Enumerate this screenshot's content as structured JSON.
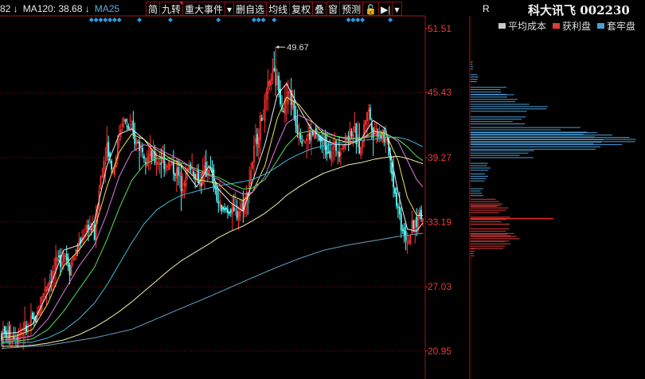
{
  "ma_legend": [
    {
      "text": "82 ↓",
      "color": "#e8e8e8"
    },
    {
      "text": "MA120: 38.68 ↓",
      "color": "#e8e8e8"
    },
    {
      "text": "MA25",
      "color": "#5fb0d6"
    }
  ],
  "toolbar": [
    {
      "label": "简",
      "flag": false
    },
    {
      "label": "九转",
      "flag": true
    },
    {
      "label": "重大事件",
      "flag": false
    },
    {
      "label": "▾",
      "flag": false
    },
    {
      "label": "删自选",
      "flag": false
    },
    {
      "label": "均线",
      "flag": false
    },
    {
      "label": "复权",
      "flag": false
    },
    {
      "label": "叠",
      "flag": false
    },
    {
      "label": "窗",
      "flag": false
    },
    {
      "label": "预测",
      "flag": false
    },
    {
      "label": "🔓",
      "flag": false
    },
    {
      "label": "▶|",
      "flag": false
    },
    {
      "label": "▾",
      "flag": false
    }
  ],
  "stock": {
    "name": "科大讯飞",
    "code": "002230",
    "title": "科大讯飞 002230",
    "corner": "R"
  },
  "chip_legend": [
    {
      "label": "平均成本",
      "color": "#c8c8c8"
    },
    {
      "label": "获利盘",
      "color": "#e23a3a"
    },
    {
      "label": "套牢盘",
      "color": "#4a9fd8"
    }
  ],
  "chip_cost_line": 33.5,
  "chart_data": {
    "type": "candlestick",
    "price_axis": {
      "ticks": [
        "51.51",
        "45.43",
        "39.27",
        "33.19",
        "27.03",
        "20.95"
      ],
      "ylim": [
        18.3,
        52.7
      ]
    },
    "peak_annotation": "49.67",
    "ma_series": [
      {
        "name": "MA5",
        "color": "#f0f0f0",
        "anchors": [
          [
            0,
            22.6
          ],
          [
            10,
            22.7
          ],
          [
            20,
            23.5
          ],
          [
            30,
            26.5
          ],
          [
            40,
            30.5
          ],
          [
            50,
            31.0
          ],
          [
            60,
            33.3
          ],
          [
            68,
            38.5
          ],
          [
            76,
            41.5
          ],
          [
            84,
            42.0
          ],
          [
            92,
            41.0
          ],
          [
            100,
            39.5
          ],
          [
            108,
            39.0
          ],
          [
            116,
            38.5
          ],
          [
            126,
            36.5
          ],
          [
            134,
            38.5
          ],
          [
            140,
            36.3
          ],
          [
            148,
            35.0
          ],
          [
            156,
            34.2
          ],
          [
            162,
            37.0
          ],
          [
            170,
            40.5
          ],
          [
            178,
            45.2
          ],
          [
            184,
            46.3
          ],
          [
            192,
            44.0
          ],
          [
            200,
            42.0
          ],
          [
            208,
            41.0
          ],
          [
            216,
            40.5
          ],
          [
            224,
            40.5
          ],
          [
            232,
            41.0
          ],
          [
            240,
            42.8
          ],
          [
            248,
            42.0
          ],
          [
            256,
            36.0
          ],
          [
            262,
            32.5
          ],
          [
            268,
            32.3
          ],
          [
            272,
            33.1
          ]
        ]
      },
      {
        "name": "MA10",
        "color": "#f2e25a",
        "anchors": [
          [
            0,
            22.2
          ],
          [
            10,
            22.4
          ],
          [
            20,
            23.0
          ],
          [
            30,
            25.5
          ],
          [
            40,
            29.0
          ],
          [
            50,
            30.5
          ],
          [
            60,
            32.5
          ],
          [
            68,
            36.5
          ],
          [
            76,
            39.8
          ],
          [
            84,
            41.5
          ],
          [
            92,
            41.0
          ],
          [
            100,
            40.0
          ],
          [
            108,
            39.3
          ],
          [
            116,
            38.6
          ],
          [
            126,
            37.2
          ],
          [
            134,
            37.0
          ],
          [
            140,
            36.8
          ],
          [
            148,
            35.7
          ],
          [
            156,
            35.2
          ],
          [
            162,
            36.0
          ],
          [
            170,
            38.5
          ],
          [
            178,
            43.0
          ],
          [
            184,
            45.0
          ],
          [
            192,
            44.3
          ],
          [
            200,
            42.8
          ],
          [
            208,
            41.5
          ],
          [
            216,
            41.0
          ],
          [
            224,
            40.7
          ],
          [
            232,
            41.0
          ],
          [
            240,
            41.8
          ],
          [
            248,
            41.6
          ],
          [
            256,
            39.0
          ],
          [
            262,
            35.5
          ],
          [
            268,
            33.8
          ],
          [
            272,
            33.8
          ]
        ]
      },
      {
        "name": "MA20",
        "color": "#e07ae0",
        "anchors": [
          [
            0,
            22.0
          ],
          [
            10,
            22.1
          ],
          [
            20,
            22.4
          ],
          [
            30,
            24.0
          ],
          [
            40,
            26.5
          ],
          [
            50,
            29.0
          ],
          [
            60,
            31.0
          ],
          [
            68,
            34.0
          ],
          [
            76,
            37.5
          ],
          [
            84,
            39.8
          ],
          [
            92,
            40.5
          ],
          [
            100,
            40.2
          ],
          [
            108,
            39.6
          ],
          [
            116,
            39.0
          ],
          [
            126,
            38.0
          ],
          [
            134,
            37.6
          ],
          [
            140,
            37.2
          ],
          [
            148,
            36.4
          ],
          [
            156,
            35.8
          ],
          [
            162,
            36.0
          ],
          [
            170,
            37.5
          ],
          [
            178,
            40.5
          ],
          [
            184,
            42.5
          ],
          [
            192,
            43.3
          ],
          [
            200,
            42.7
          ],
          [
            208,
            41.8
          ],
          [
            216,
            41.3
          ],
          [
            224,
            41.0
          ],
          [
            232,
            41.1
          ],
          [
            240,
            41.5
          ],
          [
            248,
            41.6
          ],
          [
            256,
            40.8
          ],
          [
            262,
            39.0
          ],
          [
            268,
            37.2
          ],
          [
            272,
            36.5
          ]
        ]
      },
      {
        "name": "MA30",
        "color": "#58e058",
        "anchors": [
          [
            0,
            21.8
          ],
          [
            10,
            21.9
          ],
          [
            20,
            22.1
          ],
          [
            30,
            23.0
          ],
          [
            40,
            24.7
          ],
          [
            50,
            26.8
          ],
          [
            60,
            28.9
          ],
          [
            68,
            31.5
          ],
          [
            76,
            34.5
          ],
          [
            84,
            37.1
          ],
          [
            92,
            38.6
          ],
          [
            100,
            39.2
          ],
          [
            108,
            39.2
          ],
          [
            116,
            38.8
          ],
          [
            126,
            38.2
          ],
          [
            134,
            37.7
          ],
          [
            140,
            37.4
          ],
          [
            148,
            36.8
          ],
          [
            156,
            36.3
          ],
          [
            162,
            36.4
          ],
          [
            170,
            37.2
          ],
          [
            178,
            39.0
          ],
          [
            184,
            40.4
          ],
          [
            192,
            41.6
          ],
          [
            200,
            41.8
          ],
          [
            208,
            41.6
          ],
          [
            216,
            41.3
          ],
          [
            224,
            41.1
          ],
          [
            232,
            41.1
          ],
          [
            240,
            41.3
          ],
          [
            248,
            41.5
          ],
          [
            256,
            41.0
          ],
          [
            262,
            40.3
          ],
          [
            268,
            39.4
          ],
          [
            272,
            39.0
          ]
        ]
      },
      {
        "name": "MA60",
        "color": "#44b8d8",
        "anchors": [
          [
            0,
            21.7
          ],
          [
            10,
            21.7
          ],
          [
            20,
            21.8
          ],
          [
            30,
            22.2
          ],
          [
            40,
            22.9
          ],
          [
            50,
            24.0
          ],
          [
            60,
            25.5
          ],
          [
            68,
            27.2
          ],
          [
            76,
            29.2
          ],
          [
            84,
            31.2
          ],
          [
            92,
            33.0
          ],
          [
            100,
            34.3
          ],
          [
            108,
            35.1
          ],
          [
            116,
            35.7
          ],
          [
            126,
            36.1
          ],
          [
            134,
            36.4
          ],
          [
            140,
            36.6
          ],
          [
            148,
            36.8
          ],
          [
            156,
            37.0
          ],
          [
            162,
            37.2
          ],
          [
            170,
            37.7
          ],
          [
            178,
            38.4
          ],
          [
            184,
            39.0
          ],
          [
            192,
            39.6
          ],
          [
            200,
            40.1
          ],
          [
            208,
            40.4
          ],
          [
            216,
            40.6
          ],
          [
            224,
            40.8
          ],
          [
            232,
            40.9
          ],
          [
            240,
            41.0
          ],
          [
            248,
            41.2
          ],
          [
            256,
            41.2
          ],
          [
            262,
            41.0
          ],
          [
            268,
            40.6
          ],
          [
            272,
            40.3
          ]
        ]
      },
      {
        "name": "MA120",
        "color": "#f4f0b0",
        "anchors": [
          [
            0,
            21.4
          ],
          [
            10,
            21.4
          ],
          [
            20,
            21.5
          ],
          [
            30,
            21.7
          ],
          [
            40,
            22.0
          ],
          [
            50,
            22.5
          ],
          [
            60,
            23.2
          ],
          [
            68,
            23.9
          ],
          [
            76,
            24.7
          ],
          [
            84,
            25.6
          ],
          [
            92,
            26.6
          ],
          [
            100,
            27.6
          ],
          [
            108,
            28.6
          ],
          [
            116,
            29.5
          ],
          [
            126,
            30.4
          ],
          [
            134,
            31.1
          ],
          [
            140,
            31.7
          ],
          [
            148,
            32.3
          ],
          [
            156,
            32.8
          ],
          [
            162,
            33.3
          ],
          [
            170,
            34.0
          ],
          [
            178,
            34.9
          ],
          [
            184,
            35.7
          ],
          [
            192,
            36.5
          ],
          [
            200,
            37.2
          ],
          [
            208,
            37.8
          ],
          [
            216,
            38.2
          ],
          [
            224,
            38.6
          ],
          [
            232,
            38.8
          ],
          [
            240,
            39.1
          ],
          [
            248,
            39.3
          ],
          [
            256,
            39.4
          ],
          [
            262,
            39.2
          ],
          [
            268,
            38.9
          ],
          [
            272,
            38.7
          ]
        ]
      },
      {
        "name": "MA250",
        "color": "#6aa0c0",
        "anchors": [
          [
            0,
            21.2
          ],
          [
            30,
            21.5
          ],
          [
            60,
            22.2
          ],
          [
            84,
            23.0
          ],
          [
            100,
            24.0
          ],
          [
            116,
            25.0
          ],
          [
            134,
            26.1
          ],
          [
            148,
            27.0
          ],
          [
            162,
            27.9
          ],
          [
            178,
            28.9
          ],
          [
            192,
            29.7
          ],
          [
            208,
            30.5
          ],
          [
            224,
            31.0
          ],
          [
            240,
            31.4
          ],
          [
            256,
            31.8
          ],
          [
            272,
            32.1
          ]
        ]
      }
    ],
    "price_path_anchors": [
      [
        0,
        22.5
      ],
      [
        8,
        22.6
      ],
      [
        16,
        23.0
      ],
      [
        22,
        24.0
      ],
      [
        28,
        27.0
      ],
      [
        34,
        28.5
      ],
      [
        40,
        30.5
      ],
      [
        44,
        29.0
      ],
      [
        50,
        31.0
      ],
      [
        56,
        33.0
      ],
      [
        60,
        32.0
      ],
      [
        64,
        37.5
      ],
      [
        68,
        40.5
      ],
      [
        72,
        38.0
      ],
      [
        78,
        43.0
      ],
      [
        82,
        42.0
      ],
      [
        86,
        41.0
      ],
      [
        92,
        40.0
      ],
      [
        98,
        39.0
      ],
      [
        104,
        39.0
      ],
      [
        110,
        38.5
      ],
      [
        116,
        37.0
      ],
      [
        122,
        38.5
      ],
      [
        128,
        37.0
      ],
      [
        134,
        38.5
      ],
      [
        138,
        36.0
      ],
      [
        142,
        34.0
      ],
      [
        146,
        34.5
      ],
      [
        150,
        33.8
      ],
      [
        154,
        34.5
      ],
      [
        158,
        35.5
      ],
      [
        162,
        39.0
      ],
      [
        166,
        42.0
      ],
      [
        170,
        44.0
      ],
      [
        174,
        47.0
      ],
      [
        178,
        46.5
      ],
      [
        182,
        44.0
      ],
      [
        186,
        45.5
      ],
      [
        190,
        42.5
      ],
      [
        196,
        41.0
      ],
      [
        202,
        41.5
      ],
      [
        208,
        40.5
      ],
      [
        214,
        40.0
      ],
      [
        220,
        40.5
      ],
      [
        226,
        42.0
      ],
      [
        232,
        40.0
      ],
      [
        236,
        44.0
      ],
      [
        240,
        42.0
      ],
      [
        246,
        41.5
      ],
      [
        250,
        40.0
      ],
      [
        254,
        36.0
      ],
      [
        258,
        33.0
      ],
      [
        262,
        31.5
      ],
      [
        266,
        32.5
      ],
      [
        270,
        34.0
      ],
      [
        272,
        33.5
      ]
    ],
    "chip_distribution": [
      {
        "price": 48.0,
        "width": 3,
        "kind": "trapped"
      },
      {
        "price": 46.8,
        "width": 10,
        "kind": "trapped"
      },
      {
        "price": 45.6,
        "width": 45,
        "kind": "trapped"
      },
      {
        "price": 44.9,
        "width": 60,
        "kind": "trapped"
      },
      {
        "price": 44.0,
        "width": 100,
        "kind": "trapped"
      },
      {
        "price": 42.8,
        "width": 70,
        "kind": "trapped"
      },
      {
        "price": 41.8,
        "width": 150,
        "kind": "trapped"
      },
      {
        "price": 41.3,
        "width": 200,
        "kind": "trapped"
      },
      {
        "price": 40.9,
        "width": 215,
        "kind": "trapped"
      },
      {
        "price": 40.4,
        "width": 190,
        "kind": "trapped"
      },
      {
        "price": 39.6,
        "width": 80,
        "kind": "trapped"
      },
      {
        "price": 38.4,
        "width": 25,
        "kind": "trapped"
      },
      {
        "price": 37.4,
        "width": 22,
        "kind": "trapped"
      },
      {
        "price": 36.0,
        "width": 16,
        "kind": "trapped"
      },
      {
        "price": 35.0,
        "width": 40,
        "kind": "profit"
      },
      {
        "price": 34.4,
        "width": 48,
        "kind": "profit"
      },
      {
        "price": 33.3,
        "width": 50,
        "kind": "profit"
      },
      {
        "price": 32.2,
        "width": 55,
        "kind": "profit"
      },
      {
        "price": 31.7,
        "width": 62,
        "kind": "profit"
      },
      {
        "price": 31.0,
        "width": 50,
        "kind": "profit"
      },
      {
        "price": 30.3,
        "width": 5,
        "kind": "profit"
      }
    ],
    "cost_line_price": 33.5,
    "grid_lines": [
      45.43,
      39.27,
      33.19,
      27.03,
      20.95
    ]
  }
}
